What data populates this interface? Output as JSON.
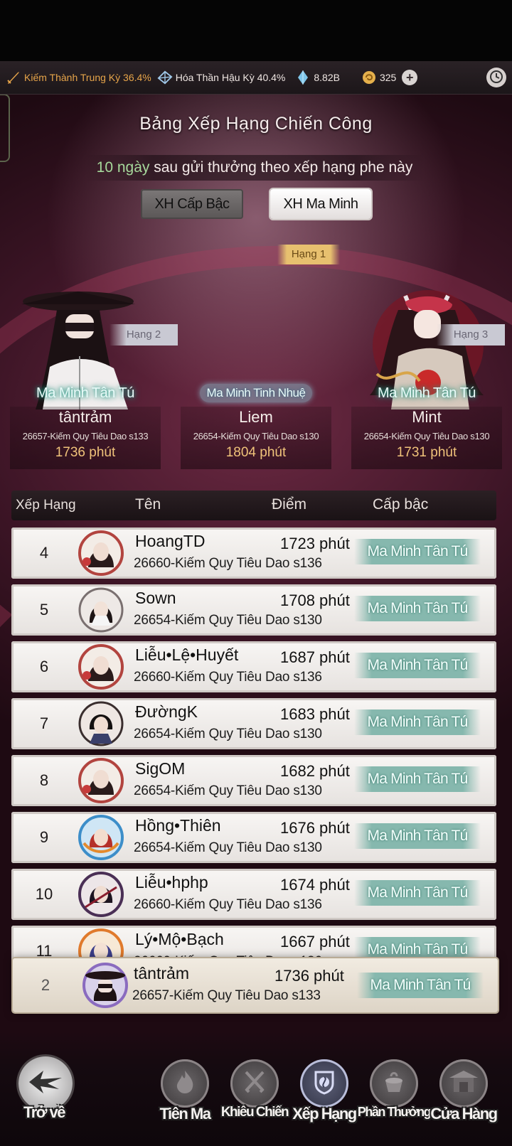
{
  "statusbar": {
    "realm1": "Kiếm Thành Trung Kỳ 36.4%",
    "realm2": "Hóa Thần Hậu Kỳ 40.4%",
    "crystal": "8.82B",
    "coins": "325",
    "plus": "+"
  },
  "header": {
    "title": "Bảng Xếp Hạng Chiến Công",
    "subtitle_days": "10 ngày",
    "subtitle_rest": " sau gửi thưởng theo xếp hạng phe này",
    "tabs": [
      "XH Cấp Bậc",
      "XH Ma Minh"
    ],
    "rank1_tag": "Hạng 1"
  },
  "podium": [
    {
      "rank_tag": "Hạng 2",
      "title": "Ma Minh Tân Tú",
      "name": "tântrảm",
      "server": "26657-Kiếm Quy Tiêu Dao s133",
      "score": "1736 phút"
    },
    {
      "title": "Ma Minh Tinh Nhuệ",
      "name": "Liem",
      "server": "26654-Kiếm Quy Tiêu Dao s130",
      "score": "1804 phút"
    },
    {
      "rank_tag": "Hạng 3",
      "title": "Ma Minh Tân Tú",
      "name": "Mint",
      "server": "26654-Kiếm Quy Tiêu Dao s130",
      "score": "1731 phút"
    }
  ],
  "table": {
    "headers": [
      "Xếp Hạng",
      "Tên",
      "Điểm",
      "Cấp bậc"
    ],
    "rows": [
      {
        "rank": "4",
        "name": "HoangTD",
        "server": "26660-Kiếm Quy Tiêu Dao s136",
        "score": "1723 phút",
        "grade": "Ma Minh Tân Tú"
      },
      {
        "rank": "5",
        "name": "Sown",
        "server": "26654-Kiếm Quy Tiêu Dao s130",
        "score": "1708 phút",
        "grade": "Ma Minh Tân Tú"
      },
      {
        "rank": "6",
        "name": "Liễu•Lệ•Huyết",
        "server": "26660-Kiếm Quy Tiêu Dao s136",
        "score": "1687 phút",
        "grade": "Ma Minh Tân Tú"
      },
      {
        "rank": "7",
        "name": "ĐườngK",
        "server": "26654-Kiếm Quy Tiêu Dao s130",
        "score": "1683 phút",
        "grade": "Ma Minh Tân Tú"
      },
      {
        "rank": "8",
        "name": "SigOM",
        "server": "26654-Kiếm Quy Tiêu Dao s130",
        "score": "1682 phút",
        "grade": "Ma Minh Tân Tú"
      },
      {
        "rank": "9",
        "name": "Hồng•Thiên",
        "server": "26654-Kiếm Quy Tiêu Dao s130",
        "score": "1676 phút",
        "grade": "Ma Minh Tân Tú"
      },
      {
        "rank": "10",
        "name": "Liễu•hphp",
        "server": "26660-Kiếm Quy Tiêu Dao s136",
        "score": "1674 phút",
        "grade": "Ma Minh Tân Tú"
      },
      {
        "rank": "11",
        "name": "Lý•Mộ•Bạch",
        "server": "26660-Kiếm Quy Tiêu Dao s136",
        "score": "1667 phút",
        "grade": "Ma Minh Tân Tú"
      }
    ]
  },
  "self": {
    "rank": "2",
    "name": "tântrảm",
    "server": "26657-Kiếm Quy Tiêu Dao s133",
    "score": "1736 phút",
    "grade": "Ma Minh Tân Tú"
  },
  "nav": {
    "back": "Trở về",
    "items": [
      "Tiên Ma",
      "Khiêu Chiến",
      "Xếp Hạng",
      "Phần Thưởng",
      "Cửa Hàng"
    ]
  }
}
